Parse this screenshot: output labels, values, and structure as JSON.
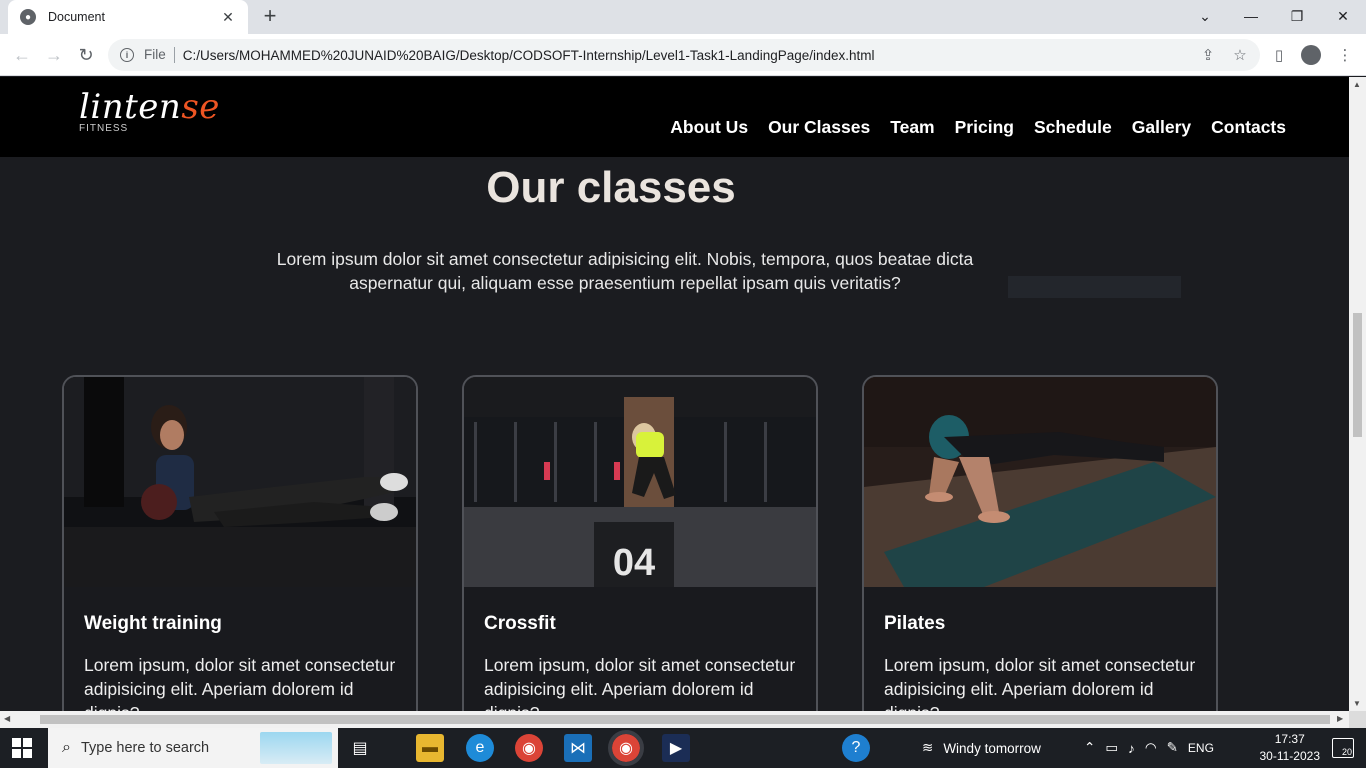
{
  "browser": {
    "tab_title": "Document",
    "tab_close": "✕",
    "new_tab": "+",
    "window_controls": [
      "⌄",
      "—",
      "❐",
      "✕"
    ],
    "back": "←",
    "forward": "→",
    "reload": "↻",
    "file_label": "File",
    "url": "C:/Users/MOHAMMED%20JUNAID%20BAIG/Desktop/CODSOFT-Internship/Level1-Task1-LandingPage/index.html"
  },
  "site": {
    "logo_main": "linten",
    "logo_accent": "se",
    "logo_tag": "FITNESS",
    "nav": [
      "About Us",
      "Our Classes",
      "Team",
      "Pricing",
      "Schedule",
      "Gallery",
      "Contacts"
    ]
  },
  "section": {
    "title": "Our classes",
    "description": "Lorem ipsum dolor sit amet consectetur adipisicing elit. Nobis, tempora, quos beatae dicta aspernatur qui, aliquam esse praesentium repellat ipsam quis veritatis?",
    "cards": [
      {
        "title": "Weight training",
        "text": "Lorem ipsum, dolor sit amet consectetur adipisicing elit. Aperiam dolorem id dignis?"
      },
      {
        "title": "Crossfit",
        "text": "Lorem ipsum, dolor sit amet consectetur adipisicing elit. Aperiam dolorem id dignis?",
        "box_number": "04"
      },
      {
        "title": "Pilates",
        "text": "Lorem ipsum, dolor sit amet consectetur adipisicing elit. Aperiam dolorem id dignis?"
      }
    ]
  },
  "taskbar": {
    "search_placeholder": "Type here to search",
    "weather": "Windy tomorrow",
    "language": "ENG",
    "time": "17:37",
    "date": "30-11-2023",
    "notification_count": "20"
  },
  "colors": {
    "accent": "#ee5523",
    "page_bg": "#1b1c20",
    "header_bg": "#000000"
  }
}
